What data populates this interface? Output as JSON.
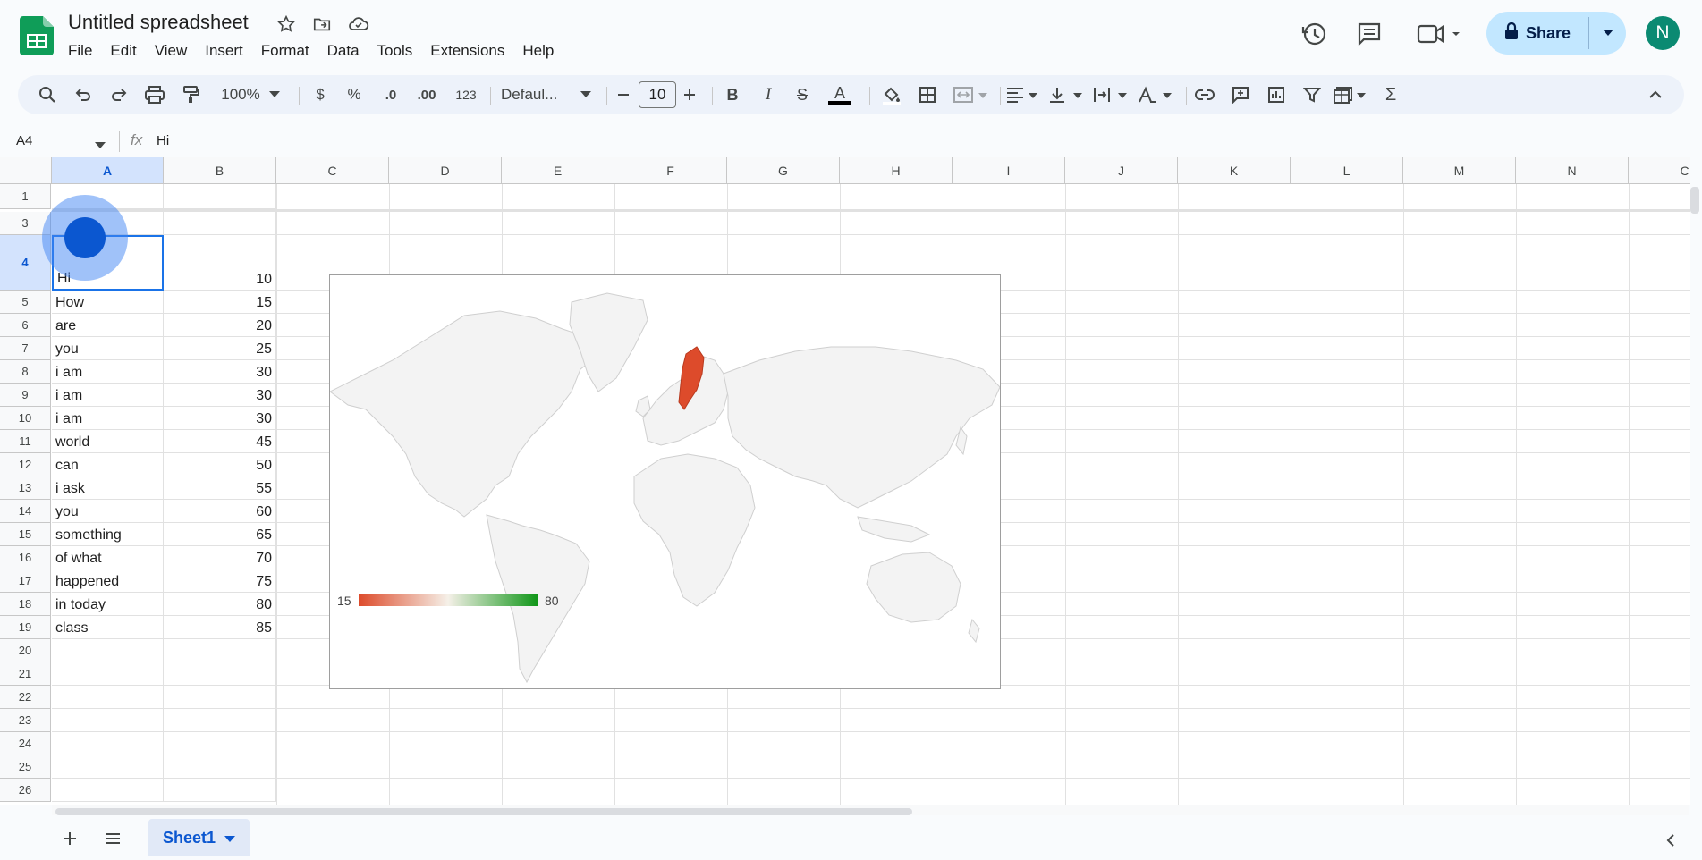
{
  "app": {
    "title": "Untitled spreadsheet"
  },
  "menu": [
    "File",
    "Edit",
    "View",
    "Insert",
    "Format",
    "Data",
    "Tools",
    "Extensions",
    "Help"
  ],
  "header": {
    "share_label": "Share",
    "avatar_initial": "N"
  },
  "toolbar": {
    "zoom": "100%",
    "currency": "$",
    "percent": "%",
    "dec_decrease": ".0",
    "dec_increase": ".00",
    "number_format": "123",
    "font": "Defaul...",
    "font_size": "10",
    "text_color": "#000000"
  },
  "formula_bar": {
    "cell_ref": "A4",
    "fx": "fx",
    "value": "Hi"
  },
  "columns": [
    "A",
    "B",
    "C",
    "D",
    "E",
    "F",
    "G",
    "H",
    "I",
    "J",
    "K",
    "L",
    "M",
    "N",
    "C"
  ],
  "rows": [
    {
      "n": "1",
      "a": "",
      "b": ""
    },
    {
      "n": "3",
      "a": "",
      "b": ""
    },
    {
      "n": "4",
      "a": "Hi",
      "b": "10"
    },
    {
      "n": "5",
      "a": "How",
      "b": "15"
    },
    {
      "n": "6",
      "a": "are",
      "b": "20"
    },
    {
      "n": "7",
      "a": "you",
      "b": "25"
    },
    {
      "n": "8",
      "a": "i am",
      "b": "30"
    },
    {
      "n": "9",
      "a": "i am",
      "b": "30"
    },
    {
      "n": "10",
      "a": "i am",
      "b": "30"
    },
    {
      "n": "11",
      "a": "world",
      "b": "45"
    },
    {
      "n": "12",
      "a": "can",
      "b": "50"
    },
    {
      "n": "13",
      "a": "i ask",
      "b": "55"
    },
    {
      "n": "14",
      "a": "you",
      "b": "60"
    },
    {
      "n": "15",
      "a": "something",
      "b": "65"
    },
    {
      "n": "16",
      "a": "of what",
      "b": "70"
    },
    {
      "n": "17",
      "a": "happened",
      "b": "75"
    },
    {
      "n": "18",
      "a": "in today",
      "b": "80"
    },
    {
      "n": "19",
      "a": "class",
      "b": "85"
    },
    {
      "n": "20",
      "a": "",
      "b": ""
    },
    {
      "n": "21",
      "a": "",
      "b": ""
    },
    {
      "n": "22",
      "a": "",
      "b": ""
    },
    {
      "n": "23",
      "a": "",
      "b": ""
    },
    {
      "n": "24",
      "a": "",
      "b": ""
    },
    {
      "n": "25",
      "a": "",
      "b": ""
    },
    {
      "n": "26",
      "a": "",
      "b": ""
    }
  ],
  "chart_data": {
    "type": "geo",
    "region": "world",
    "highlighted": [
      {
        "region": "Sweden",
        "color": "#dd4b2b"
      }
    ],
    "legend": {
      "min": "15",
      "max": "80",
      "colors": [
        "#dd4b2b",
        "#f5f5f5",
        "#109618"
      ]
    }
  },
  "sheets": [
    {
      "name": "Sheet1",
      "active": true
    }
  ],
  "colors": {
    "accent": "#0b57d0",
    "share_bg": "#c2e7ff",
    "avatar": "#0b8a72",
    "selection": "#d3e3fd"
  }
}
